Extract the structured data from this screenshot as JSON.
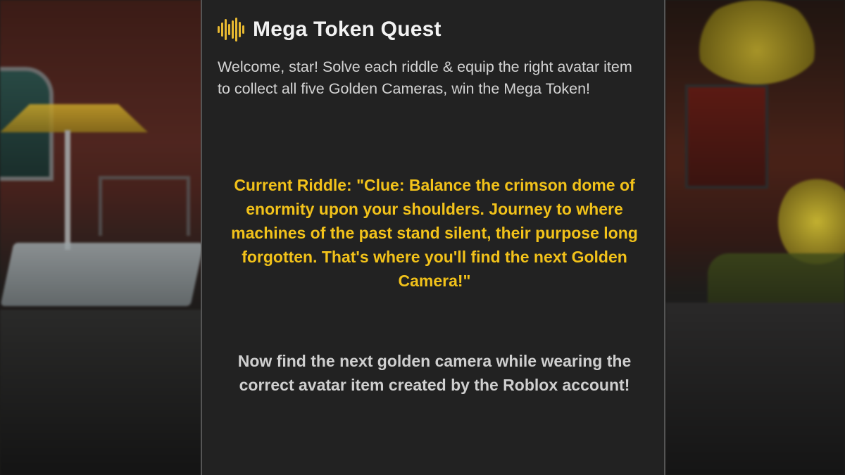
{
  "quest": {
    "title": "Mega Token Quest",
    "icon": "sound-wave-icon",
    "welcome_text": "Welcome, star! Solve each riddle & equip the right avatar item to collect all five Golden Cameras, win the Mega Token!",
    "riddle_text": "Current Riddle: \"Clue: Balance the crimson dome of enormity upon your shoulders. Journey to where machines of the past stand silent, their purpose long forgotten. That's where you'll find the next Golden Camera!\"",
    "instruction_text": "Now find the next golden camera while wearing the correct avatar item created by the Roblox account!"
  },
  "colors": {
    "panel_background": "#222222",
    "accent_gold": "#f2c21a",
    "title_text": "#f2f2f2",
    "body_text": "#d4d4d4"
  }
}
